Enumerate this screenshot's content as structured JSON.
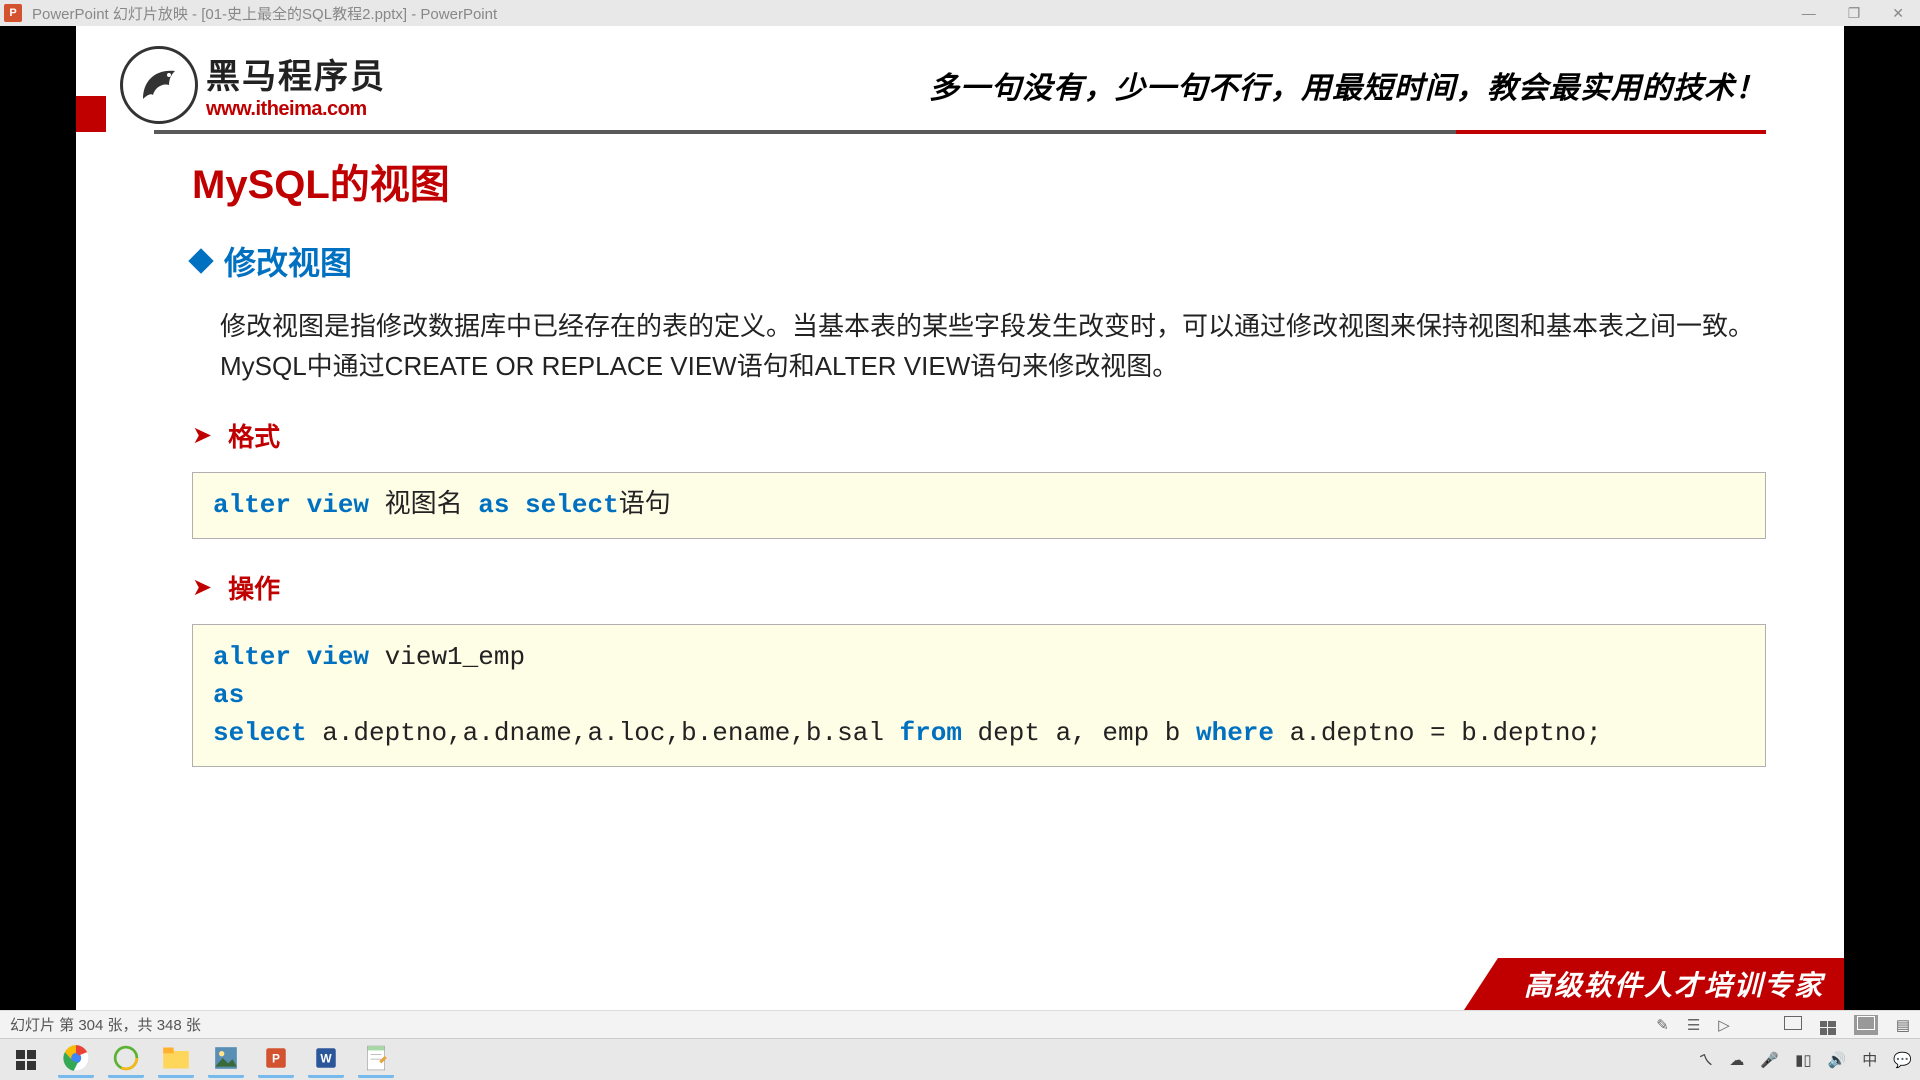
{
  "titlebar": {
    "icon_letter": "P",
    "title": "PowerPoint 幻灯片放映 - [01-史上最全的SQL教程2.pptx] - PowerPoint",
    "minimize": "—",
    "maximize": "❐",
    "close": "✕"
  },
  "header": {
    "logo_cn": "黑马程序员",
    "logo_url": "www.itheima.com",
    "slogan": "多一句没有，少一句不行，用最短时间，教会最实用的技术！"
  },
  "slide": {
    "title": "MySQL的视图",
    "subtitle": "修改视图",
    "paragraph": "修改视图是指修改数据库中已经存在的表的定义。当基本表的某些字段发生改变时，可以通过修改视图来保持视图和基本表之间一致。MySQL中通过CREATE OR REPLACE VIEW语句和ALTER VIEW语句来修改视图。",
    "label_format": "格式",
    "label_operation": "操作",
    "code1": {
      "kw1": "alter view",
      "t1": " 视图名 ",
      "kw2": "as select",
      "t2": "语句"
    },
    "code2": {
      "kw1": "alter view",
      "t1": " view1_emp",
      "kw2": "as",
      "kw3": "select",
      "t2": " a.deptno,a.dname,a.loc,b.ename,b.sal ",
      "kw4": "from",
      "t3": " dept a, emp b ",
      "kw5": "where",
      "t4": " a.deptno = b.deptno;"
    },
    "footer": "高级软件人才培训专家"
  },
  "statusbar": {
    "text": "幻灯片 第 304 张，共 348 张"
  }
}
